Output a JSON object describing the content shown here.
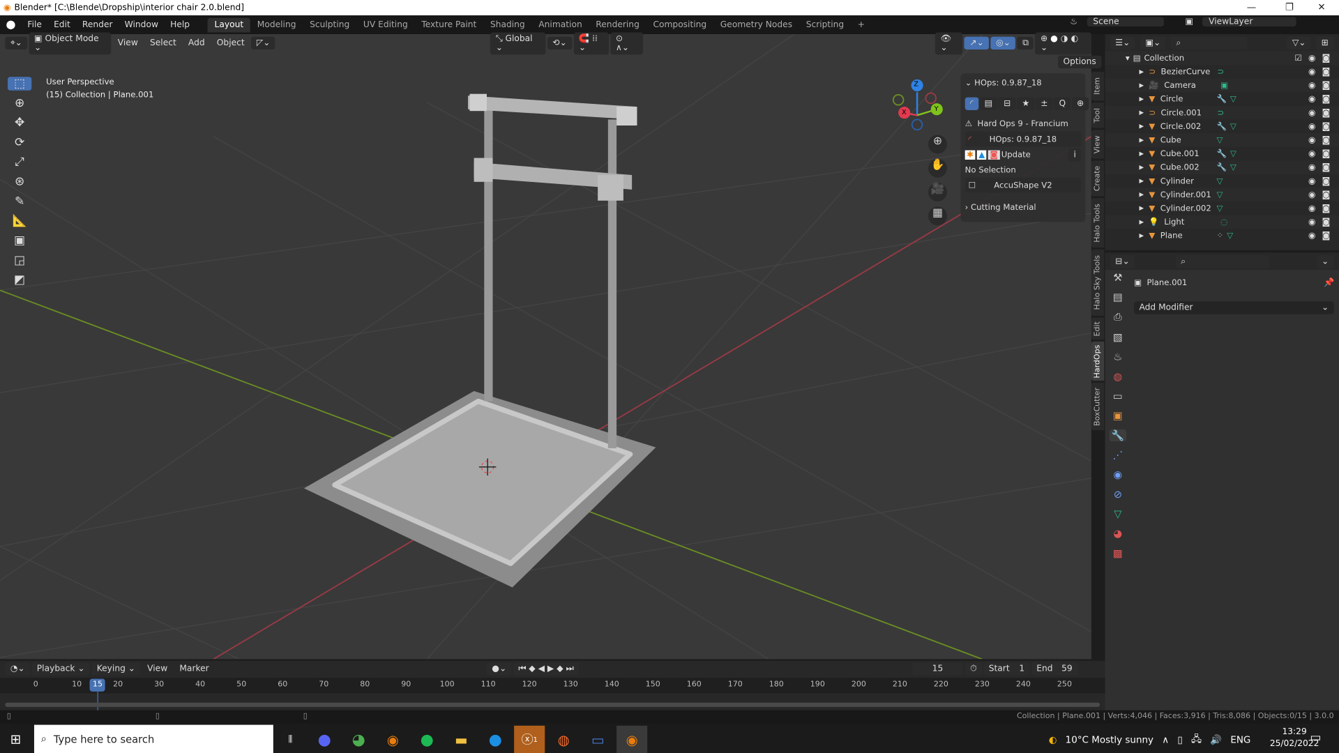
{
  "window": {
    "title": "Blender* [C:\\Blende\\Dropship\\interior chair 2.0.blend]",
    "controls": [
      "—",
      "❐",
      "✕"
    ]
  },
  "menu": [
    "File",
    "Edit",
    "Render",
    "Window",
    "Help"
  ],
  "workspaces": [
    "Layout",
    "Modeling",
    "Sculpting",
    "UV Editing",
    "Texture Paint",
    "Shading",
    "Animation",
    "Rendering",
    "Compositing",
    "Geometry Nodes",
    "Scripting",
    "+"
  ],
  "active_workspace": "Layout",
  "scene": {
    "scene_label": "Scene",
    "view_layer": "ViewLayer"
  },
  "viewport_header": {
    "mode": "Object Mode",
    "menus": [
      "View",
      "Select",
      "Add",
      "Object"
    ],
    "orientation": "Global",
    "options": "Options"
  },
  "viewport": {
    "perspective": "User Perspective",
    "collection_info": "(15) Collection | Plane.001",
    "axis_labels": {
      "x": "X",
      "y": "Y",
      "z": "Z"
    },
    "axis_colors": {
      "x": "#e23a4f",
      "y": "#80c31c",
      "z": "#2e83e6"
    }
  },
  "hops_panel": {
    "header": "HOps: 0.9.87_18",
    "title": "Hard Ops 9 - Francium",
    "version_button": "HOps: 0.9.87_18",
    "update": "Update",
    "no_selection": "No Selection",
    "accushape": "AccuShape V2",
    "cutting_material": "Cutting Material"
  },
  "side_tabs": [
    "Item",
    "Tool",
    "View",
    "Create",
    "Halo Tools",
    "Halo Sky Tools",
    "Edit",
    "HardOps",
    "BoxCutter"
  ],
  "active_side_tab": "HardOps",
  "outliner": {
    "collection": "Collection",
    "items": [
      {
        "name": "BezierCurve",
        "type": "curve",
        "extras": [
          "curve-data"
        ]
      },
      {
        "name": "Camera",
        "type": "camera",
        "extras": [
          "camera-data"
        ]
      },
      {
        "name": "Circle",
        "type": "mesh",
        "extras": [
          "modifier",
          "mesh-data"
        ]
      },
      {
        "name": "Circle.001",
        "type": "curve",
        "extras": [
          "curve-data"
        ]
      },
      {
        "name": "Circle.002",
        "type": "mesh",
        "extras": [
          "modifier",
          "mesh-data"
        ]
      },
      {
        "name": "Cube",
        "type": "mesh",
        "extras": [
          "mesh-data"
        ]
      },
      {
        "name": "Cube.001",
        "type": "mesh",
        "extras": [
          "modifier",
          "mesh-data"
        ]
      },
      {
        "name": "Cube.002",
        "type": "mesh",
        "extras": [
          "modifier",
          "mesh-data"
        ]
      },
      {
        "name": "Cylinder",
        "type": "mesh",
        "extras": [
          "mesh-data"
        ]
      },
      {
        "name": "Cylinder.001",
        "type": "mesh",
        "extras": [
          "mesh-data"
        ]
      },
      {
        "name": "Cylinder.002",
        "type": "mesh",
        "extras": [
          "mesh-data"
        ]
      },
      {
        "name": "Light",
        "type": "light",
        "extras": [
          "light-data"
        ]
      },
      {
        "name": "Plane",
        "type": "mesh",
        "extras": [
          "particles",
          "mesh-data"
        ]
      }
    ]
  },
  "properties": {
    "object": "Plane.001",
    "add_modifier": "Add Modifier",
    "active_tab": "modifiers"
  },
  "timeline": {
    "menus": [
      "Playback",
      "Keying",
      "View",
      "Marker"
    ],
    "current_frame": "15",
    "start_label": "Start",
    "start": "1",
    "end_label": "End",
    "end": "59",
    "ticks": [
      "0",
      "10",
      "20",
      "30",
      "40",
      "50",
      "60",
      "70",
      "80",
      "90",
      "100",
      "110",
      "120",
      "130",
      "140",
      "150",
      "160",
      "170",
      "180",
      "190",
      "200",
      "210",
      "220",
      "230",
      "240",
      "250"
    ]
  },
  "status_bar": "Collection | Plane.001 | Verts:4,046 | Faces:3,916 | Tris:8,086 | Objects:0/15 | 3.0.0",
  "taskbar": {
    "search_placeholder": "Type here to search",
    "weather": "10°C  Mostly sunny",
    "language": "ENG",
    "time": "13:29",
    "date": "25/02/2022",
    "xbox_badge": "1"
  }
}
